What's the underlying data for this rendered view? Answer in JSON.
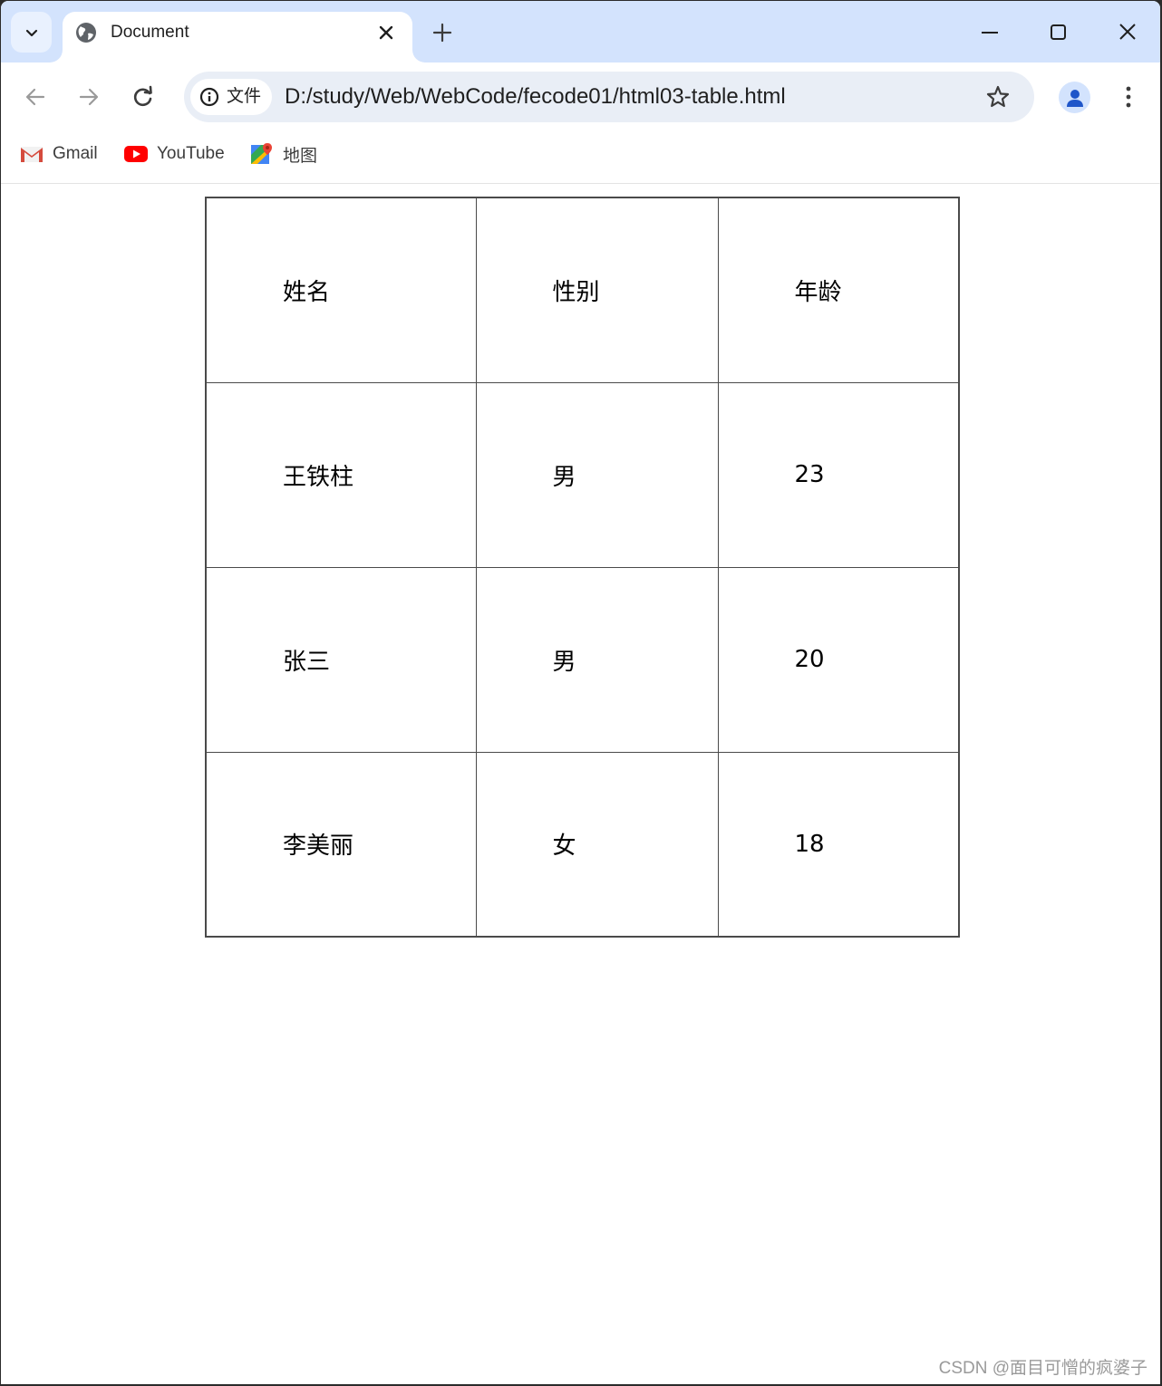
{
  "browser": {
    "tab": {
      "title": "Document",
      "favicon": "globe-icon"
    },
    "window_controls": [
      "minimize",
      "maximize",
      "close"
    ],
    "address_bar": {
      "site_chip_label": "文件",
      "url": "D:/study/Web/WebCode/fecode01/html03-table.html"
    },
    "bookmarks": [
      {
        "label": "Gmail",
        "icon": "gmail-icon"
      },
      {
        "label": "YouTube",
        "icon": "youtube-icon"
      },
      {
        "label": "地图",
        "icon": "maps-icon"
      }
    ]
  },
  "table": {
    "header": [
      "姓名",
      "性别",
      "年龄"
    ],
    "rows": [
      [
        "王铁柱",
        "男",
        "23"
      ],
      [
        "张三",
        "男",
        "20"
      ],
      [
        "李美丽",
        "女",
        "18"
      ]
    ]
  },
  "watermark": "CSDN @面目可憎的疯婆子",
  "colors": {
    "tabstrip_bg": "#d3e3fd",
    "omnibox_bg": "#e9eef6",
    "table_border": "#4a4a4a",
    "profile_accent": "#1f56c9"
  }
}
